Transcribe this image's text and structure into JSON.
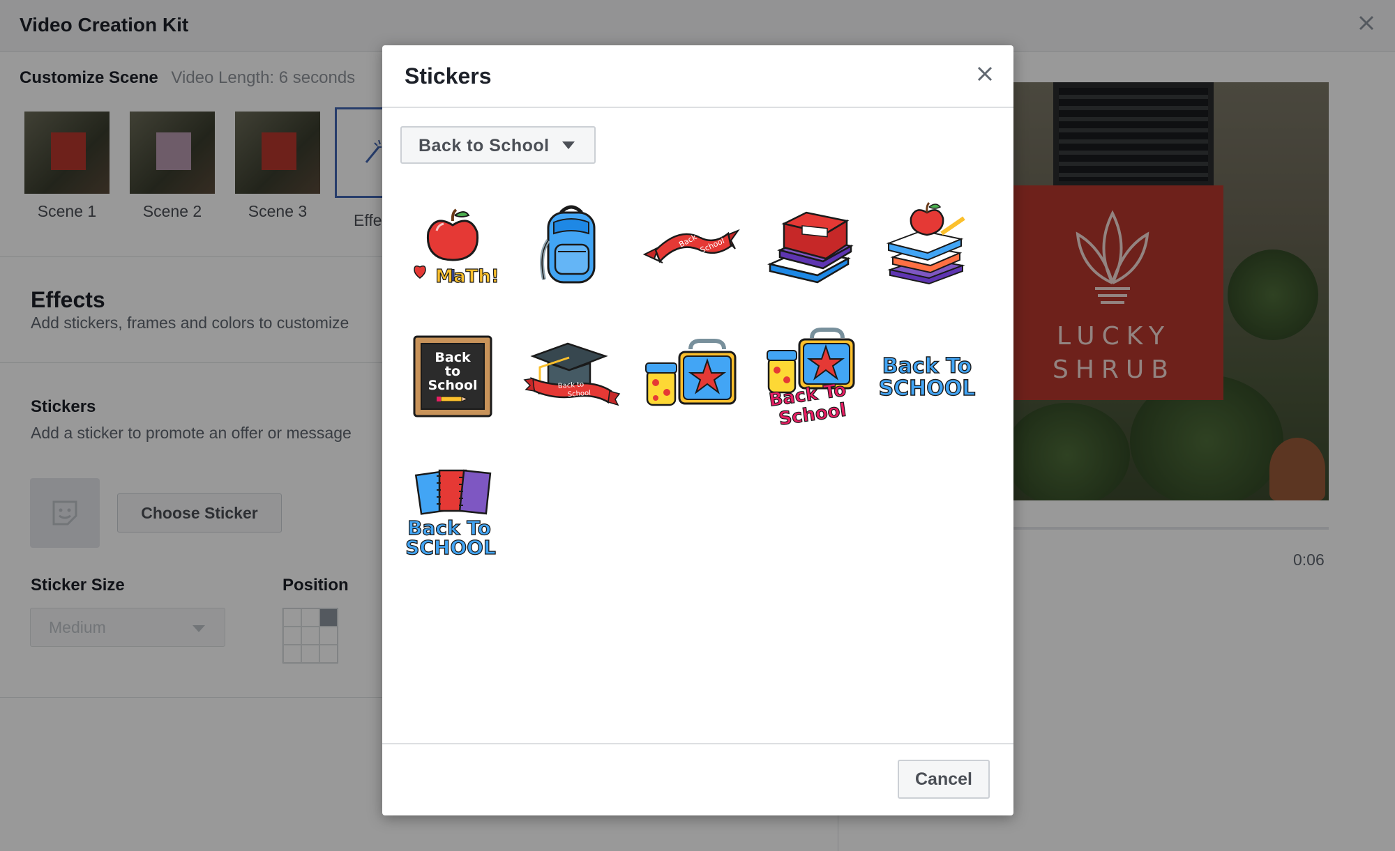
{
  "app": {
    "title": "Video Creation Kit",
    "customize_title": "Customize Scene",
    "video_length": "Video Length: 6 seconds",
    "scenes": [
      {
        "label": "Scene 1"
      },
      {
        "label": "Scene 2"
      },
      {
        "label": "Scene 3"
      }
    ],
    "effects_tab_label": "Effects",
    "effects": {
      "title": "Effects",
      "subtitle": "Add stickers, frames and colors to customize"
    },
    "stickers_section": {
      "title": "Stickers",
      "subtitle": "Add a sticker to promote an offer or message",
      "choose_button": "Choose Sticker",
      "size_label": "Sticker Size",
      "size_value": "Medium",
      "position_label": "Position"
    },
    "preview": {
      "brand_line1": "LUCKY",
      "brand_line2": "SHRUB",
      "timecode": "0:06"
    }
  },
  "modal": {
    "title": "Stickers",
    "category": "Back to School",
    "cancel_label": "Cancel",
    "stickers": [
      {
        "name": "i-love-math",
        "text": "I ♥ MaTh!"
      },
      {
        "name": "backpack",
        "text": ""
      },
      {
        "name": "back-to-school-ribbon",
        "text": "Back to School"
      },
      {
        "name": "book-stack",
        "text": ""
      },
      {
        "name": "apple-on-books",
        "text": ""
      },
      {
        "name": "chalkboard",
        "text": "Back to School"
      },
      {
        "name": "graduation-cap",
        "text": "Back to School"
      },
      {
        "name": "lunchbox",
        "text": ""
      },
      {
        "name": "lunchbox-back-to-school",
        "text": "Back To School"
      },
      {
        "name": "back-to-school-text",
        "text": "Back To School"
      },
      {
        "name": "notebooks-back-to-school",
        "text": "Back To School"
      }
    ]
  },
  "colors": {
    "accent": "#4267b2",
    "brand_red": "#b8382d",
    "overlay": "rgba(0,0,0,0.4)"
  }
}
